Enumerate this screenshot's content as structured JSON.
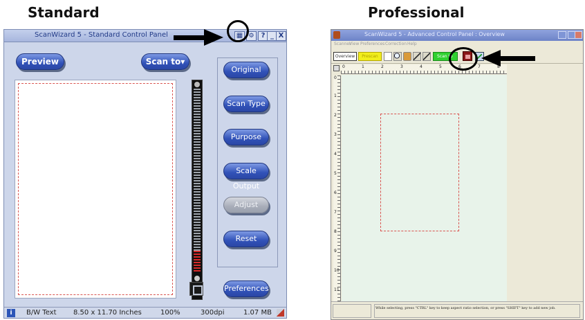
{
  "headings": {
    "standard": "Standard",
    "professional": "Professional"
  },
  "standard": {
    "title": "ScanWizard 5 - Standard Control Panel",
    "titlebar_help": "?",
    "titlebar_min": "_",
    "titlebar_close": "X",
    "buttons": {
      "preview": "Preview",
      "scan_to": "Scan to▾",
      "original": "Original",
      "scan_type": "Scan Type",
      "purpose": "Purpose",
      "scale_output": "Scale Output",
      "adjust": "Adjust",
      "reset": "Reset",
      "preferences": "Preferences"
    },
    "status": {
      "info": "i",
      "scan_type": "B/W Text",
      "size": "8.50 x 11.70 Inches",
      "zoom": "100%",
      "dpi": "300dpi",
      "filesize": "1.07 MB"
    },
    "icons": [
      "switch-panel-icon",
      "settings-icon",
      "help-icon",
      "minimize-icon",
      "close-icon",
      "zoom-window-icon"
    ],
    "colors": {
      "panel_bg": "#cdd6ea",
      "button_blue": "#3152b8",
      "frame_dash": "#d9534f"
    }
  },
  "professional": {
    "title": "ScanWizard 5 - Advanced Control Panel : Overview",
    "menu": [
      "Scanner",
      "View",
      "Preferences",
      "Correction",
      "Help"
    ],
    "toolbar": {
      "overview": "Overview",
      "prescan": "Prescan",
      "scan_to": "Scan to"
    },
    "ruler_top": [
      "0",
      "1",
      "2",
      "3",
      "4",
      "5",
      "6",
      "7",
      "8"
    ],
    "ruler_left": [
      "0",
      "1",
      "2",
      "3",
      "4",
      "5",
      "6",
      "7",
      "8",
      "9",
      "10",
      "11"
    ],
    "status_message": "While selecting, press \"CTRL\" key to keep aspect ratio selection, or press \"SHIFT\" key to add new job.",
    "icons": [
      "frame-icon",
      "zoom-icon",
      "hand-icon",
      "eyedropper-icon",
      "switch-panel-icon",
      "close-panel-icon"
    ],
    "colors": {
      "canvas_bg": "#e8f3ea",
      "prescan_yellow": "#f1ee1c",
      "scan_green": "#2fd12f"
    }
  }
}
